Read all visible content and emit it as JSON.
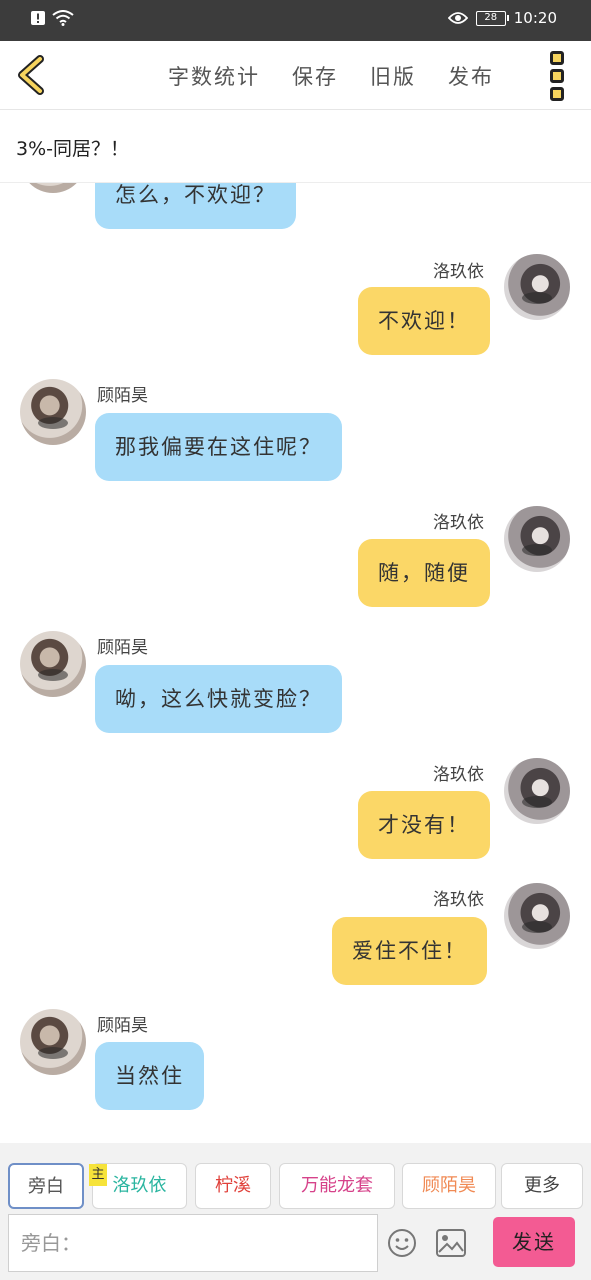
{
  "status_bar": {
    "battery": "28",
    "time": "10:20"
  },
  "toolbar": {
    "word_count": "字数统计",
    "save": "保存",
    "old_version": "旧版",
    "publish": "发布"
  },
  "chapter_title": "3%-同居？！",
  "names": {
    "girl": "洛玖依",
    "boy": "顾陌昊"
  },
  "messages": [
    {
      "text": "怎么，不欢迎？"
    },
    {
      "sender": "洛玖依",
      "text": "不欢迎！"
    },
    {
      "sender": "顾陌昊",
      "text": "那我偏要在这住呢？"
    },
    {
      "sender": "洛玖依",
      "text": "随，随便"
    },
    {
      "sender": "顾陌昊",
      "text": "呦，这么快就变脸？"
    },
    {
      "sender": "洛玖依",
      "text": "才没有！"
    },
    {
      "sender": "洛玖依",
      "text": "爱住不住！"
    },
    {
      "sender": "顾陌昊",
      "text": "当然住"
    }
  ],
  "roles": [
    {
      "label": "旁白",
      "color": "#555555"
    },
    {
      "label": "洛玖依",
      "color": "#2bb5a0",
      "tag": "主"
    },
    {
      "label": "柠溪",
      "color": "#e0403a"
    },
    {
      "label": "万能龙套",
      "color": "#d6428a"
    },
    {
      "label": "顾陌昊",
      "color": "#f08a54"
    },
    {
      "label": "更多",
      "color": "#444444"
    }
  ],
  "input": {
    "placeholder": "旁白："
  },
  "send_label": "发送"
}
